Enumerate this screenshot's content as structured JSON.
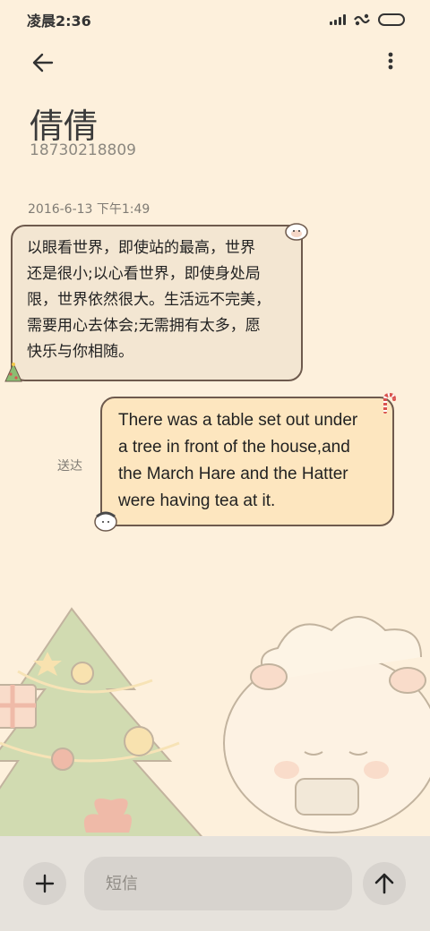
{
  "status_bar": {
    "time": "凌晨2:36"
  },
  "header": {
    "back_icon": "back-arrow-icon",
    "more_icon": "more-vertical-icon"
  },
  "contact": {
    "name": "倩倩",
    "phone": "18730218809"
  },
  "conversation": {
    "date": "2016-6-13 下午1:49",
    "incoming": {
      "lines": [
        "以眼看世界，即使站的最高，世界",
        "还是很小;以心看世界，即使身处局",
        "限，世界依然很大。生活远不完美，",
        "需要用心去体会;无需拥有太多，愿",
        "快乐与你相随。"
      ]
    },
    "outgoing": {
      "lines": [
        "There was a table set out under",
        "a tree in front of the house,and",
        "the March Hare and the Hatter",
        "were having tea at it."
      ],
      "status": "送达"
    }
  },
  "composer": {
    "add_icon": "plus-icon",
    "placeholder": "短信",
    "send_icon": "arrow-up-icon"
  },
  "colors": {
    "background": "#fdf0dc",
    "incoming_bubble": "#f3e6d2",
    "outgoing_bubble": "#fde6bf",
    "bubble_border": "#6e5a4d",
    "bottom_bar": "#e6e2dc"
  }
}
